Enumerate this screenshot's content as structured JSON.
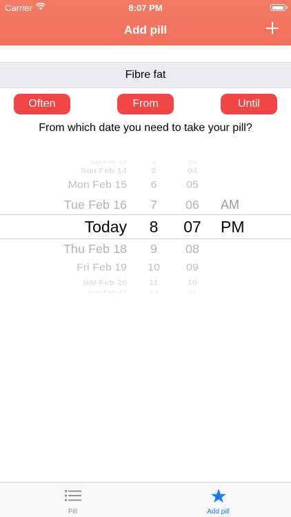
{
  "status_bar": {
    "carrier": "Carrier",
    "time": "8:07 PM",
    "battery_level": 1.0
  },
  "nav": {
    "title": "Add pill",
    "add_icon": "plus-icon"
  },
  "pill_name": "Fibre fat",
  "segments": {
    "often": "Often",
    "from": "From",
    "until": "Until"
  },
  "question": "From which date you need to take your pill?",
  "picker": {
    "dates": [
      "Sat Feb 13",
      "Sun Feb 14",
      "Mon Feb 15",
      "Tue Feb 16",
      "Today",
      "Thu Feb 18",
      "Fri Feb 19",
      "Sat Feb 20",
      "Sun Feb 21"
    ],
    "hours": [
      "4",
      "5",
      "6",
      "7",
      "8",
      "9",
      "10",
      "11",
      "12"
    ],
    "minutes": [
      "03",
      "04",
      "05",
      "06",
      "07",
      "08",
      "09",
      "10",
      "11"
    ],
    "ampm": [
      "AM",
      "PM"
    ],
    "selected": {
      "date": "Today",
      "hour": "8",
      "minute": "07",
      "ampm": "PM"
    }
  },
  "tabs": [
    {
      "label": "Pill",
      "icon": "list-icon",
      "active": false
    },
    {
      "label": "Add pill",
      "icon": "star-icon",
      "active": true
    }
  ],
  "colors": {
    "nav": "#f2705c",
    "button": "#f24545",
    "tab_active": "#1a7cf5",
    "tab_inactive": "#929292"
  }
}
